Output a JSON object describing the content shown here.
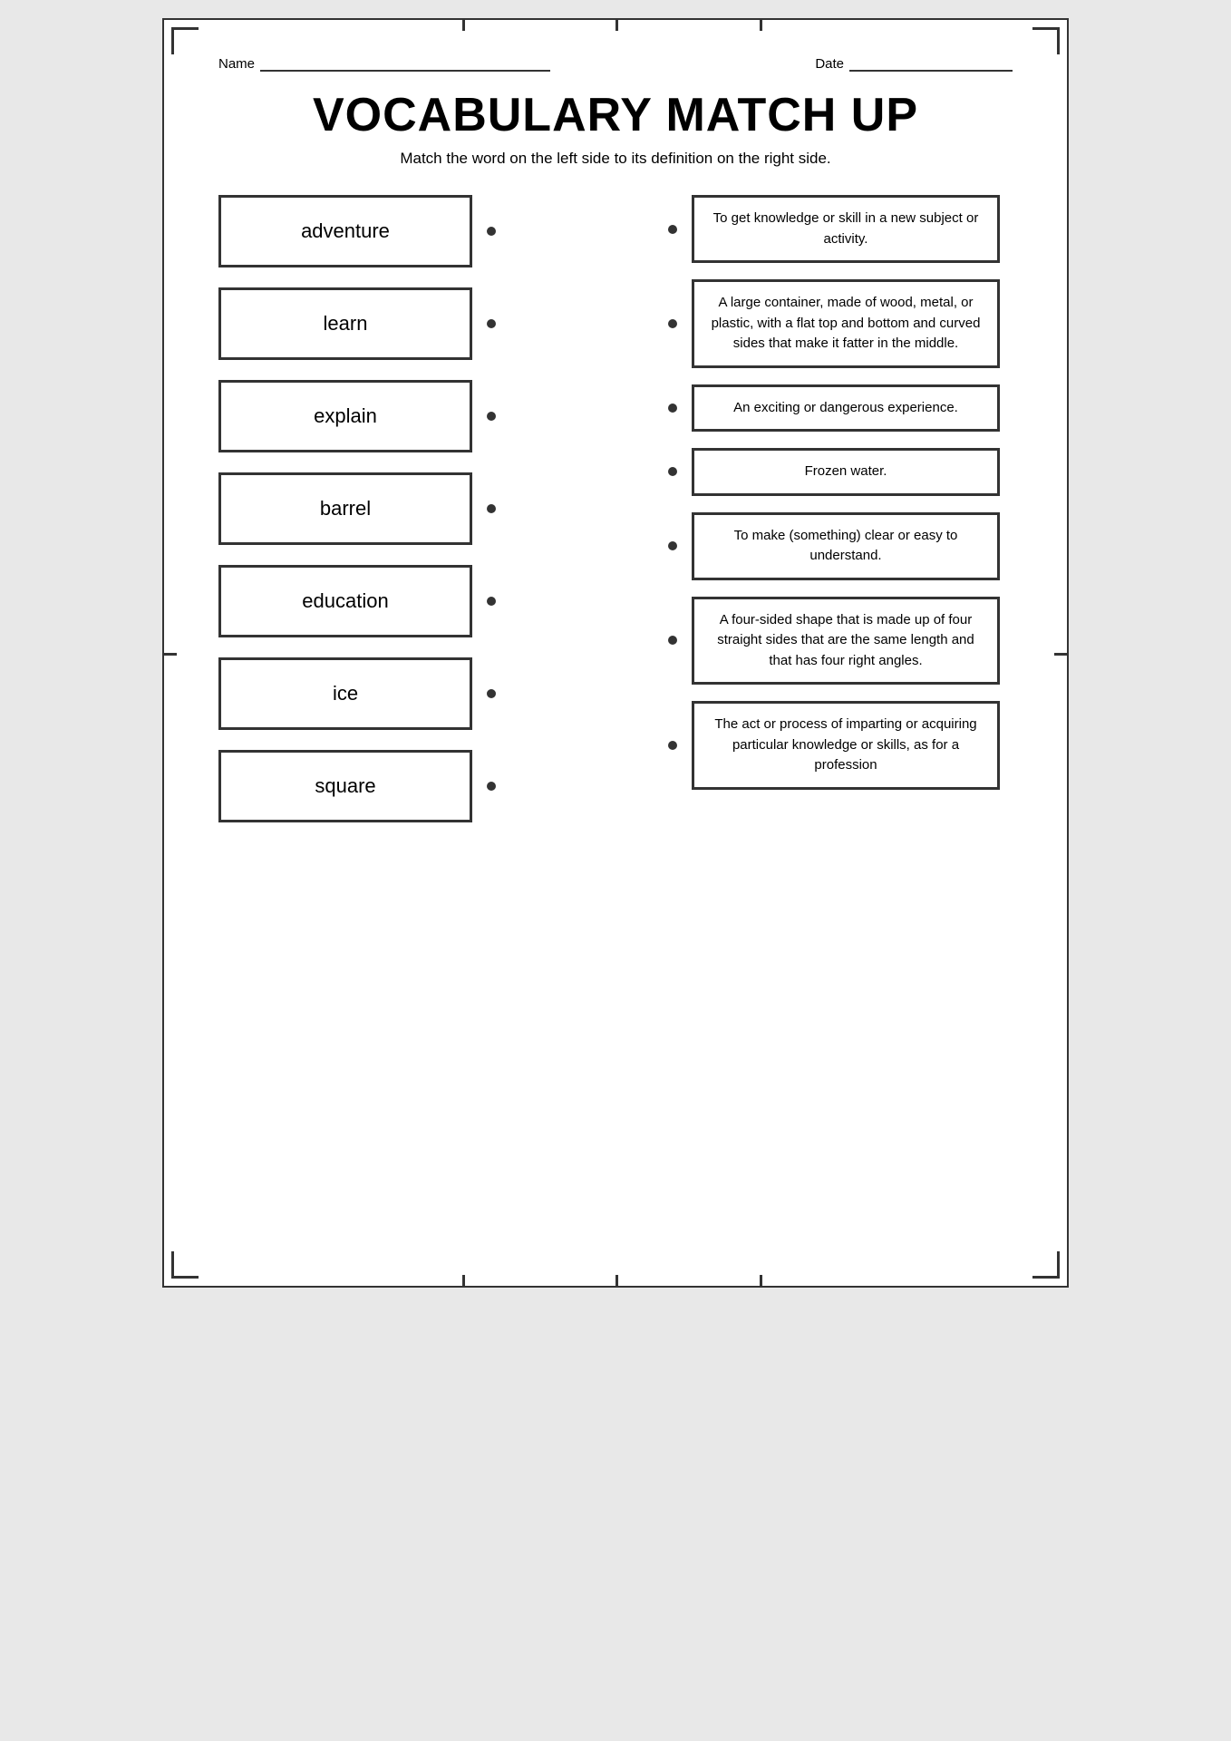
{
  "header": {
    "name_label": "Name",
    "date_label": "Date"
  },
  "title": "VOCABULARY MATCH UP",
  "subtitle": "Match the word on the left side to its definition on the right side.",
  "words": [
    {
      "id": "adventure",
      "label": "adventure"
    },
    {
      "id": "learn",
      "label": "learn"
    },
    {
      "id": "explain",
      "label": "explain"
    },
    {
      "id": "barrel",
      "label": "barrel"
    },
    {
      "id": "education",
      "label": "education"
    },
    {
      "id": "ice",
      "label": "ice"
    },
    {
      "id": "square",
      "label": "square"
    }
  ],
  "definitions": [
    {
      "id": "def-learn",
      "text": "To get knowledge or skill in a new subject or activity."
    },
    {
      "id": "def-barrel",
      "text": "A large container, made of wood, metal, or plastic, with a flat top and bottom and curved sides that make it fatter in the middle."
    },
    {
      "id": "def-adventure",
      "text": "An exciting or dangerous experience."
    },
    {
      "id": "def-ice",
      "text": "Frozen water."
    },
    {
      "id": "def-explain",
      "text": "To make (something) clear or easy to understand."
    },
    {
      "id": "def-square",
      "text": "A four-sided shape that is made up of four straight sides that are the same length and that has four right angles."
    },
    {
      "id": "def-education",
      "text": "The act or process of imparting or acquiring particular knowledge or skills, as for a profession"
    }
  ]
}
